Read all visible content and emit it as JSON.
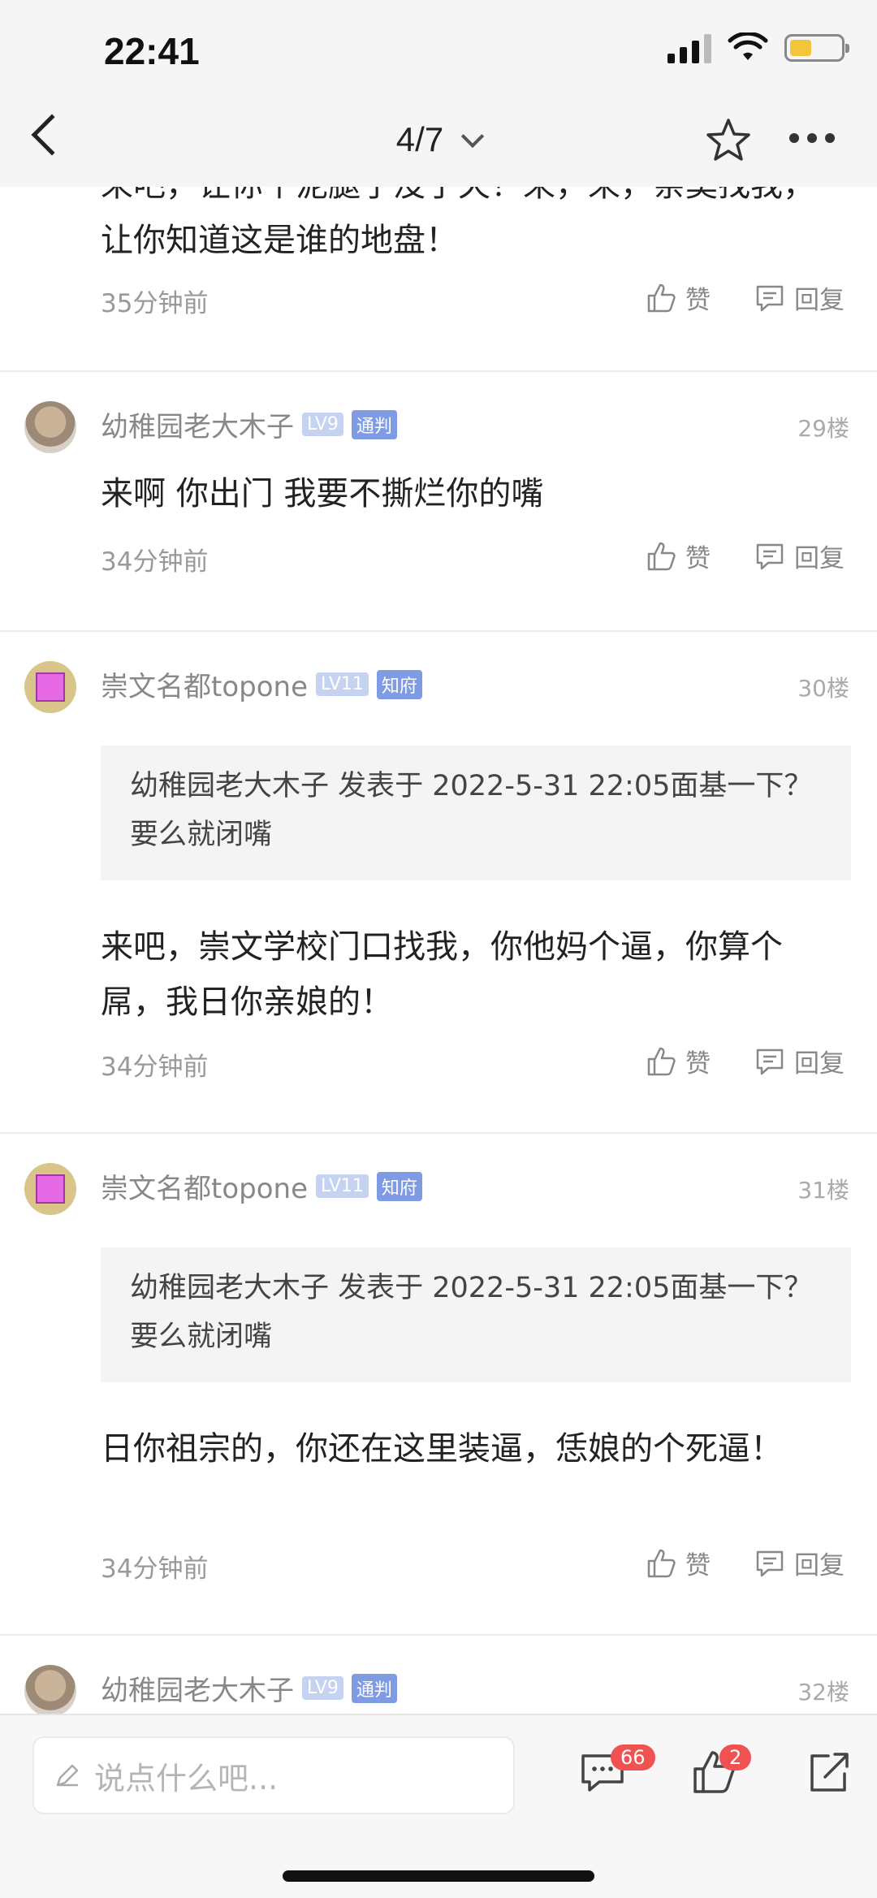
{
  "status": {
    "time": "22:41"
  },
  "nav": {
    "title": "4/7"
  },
  "comments": [
    {
      "partial_text": "来吧，让你个泥腿子没了天！来，来，亲莫找我，让你知道这是谁的地盘！",
      "time": "35分钟前",
      "like": "赞",
      "reply": "回复"
    },
    {
      "user": "幼稚园老大木子",
      "lv": "LV9",
      "title": "通判",
      "floor": "29楼",
      "text": "来啊 你出门 我要不撕烂你的嘴",
      "time": "34分钟前",
      "like": "赞",
      "reply": "回复"
    },
    {
      "user": "崇文名都topone",
      "lv": "LV11",
      "title": "知府",
      "floor": "30楼",
      "quote": "幼稚园老大木子 发表于 2022-5-31 22:05面基一下？要么就闭嘴",
      "text": "来吧，崇文学校门口找我，你他妈个逼，你算个屌，我日你亲娘的！",
      "time": "34分钟前",
      "like": "赞",
      "reply": "回复"
    },
    {
      "user": "崇文名都topone",
      "lv": "LV11",
      "title": "知府",
      "floor": "31楼",
      "quote": "幼稚园老大木子 发表于 2022-5-31 22:05面基一下？要么就闭嘴",
      "text": "日你祖宗的，你还在这里装逼，恁娘的个死逼！",
      "time": "34分钟前",
      "like": "赞",
      "reply": "回复"
    },
    {
      "user": "幼稚园老大木子",
      "lv": "LV9",
      "title": "通判",
      "floor": "32楼"
    }
  ],
  "bottom": {
    "placeholder": "说点什么吧...",
    "comment_count": "66",
    "like_count": "2"
  },
  "icons": [
    "back-icon",
    "chevron-down-icon",
    "star-icon",
    "more-icon",
    "thumbs-up-icon",
    "reply-icon",
    "pencil-icon",
    "comment-icon",
    "share-icon"
  ]
}
